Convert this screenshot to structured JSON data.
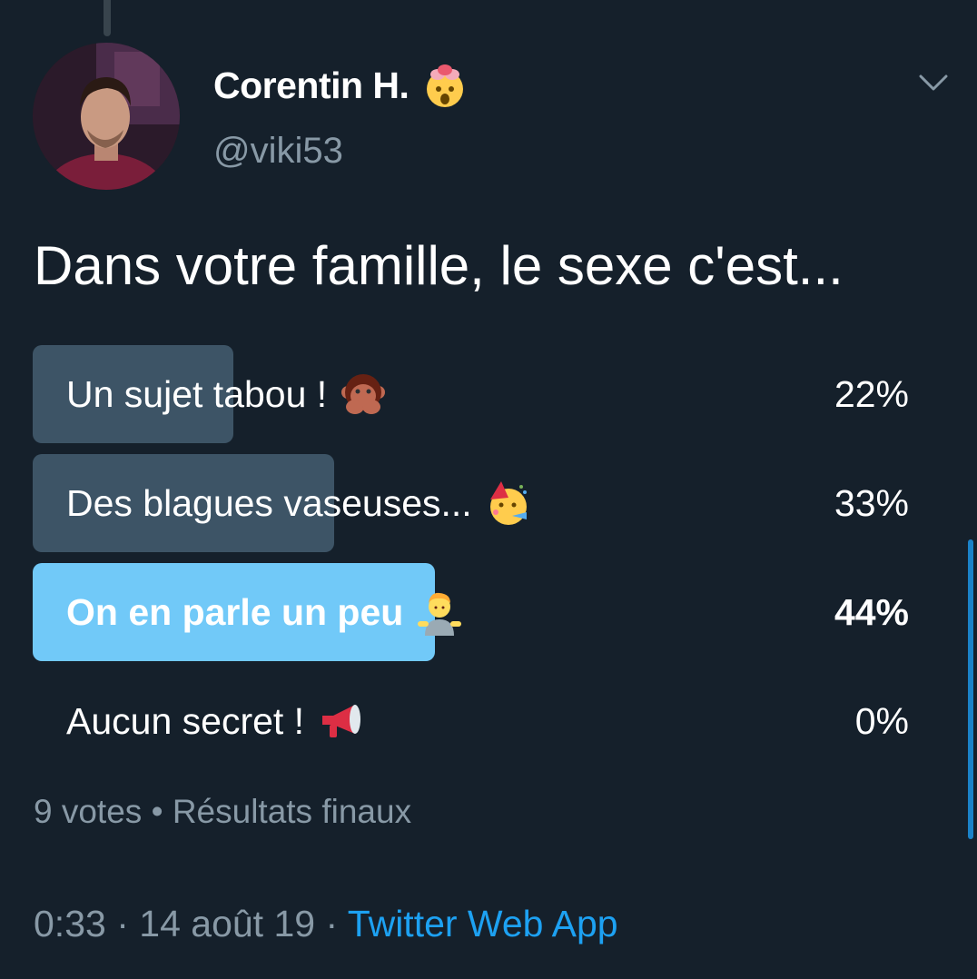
{
  "author": {
    "display_name": "Corentin H.",
    "name_emoji": "exploding-head-emoji",
    "handle": "@viki53"
  },
  "tweet": {
    "text": "Dans votre famille, le sexe c'est..."
  },
  "poll": {
    "options": [
      {
        "label": "Un sujet tabou !",
        "emoji": "speak-no-evil-monkey-emoji",
        "percent_label": "22%",
        "percent": 22,
        "winner": false
      },
      {
        "label": "Des blagues vaseuses...",
        "emoji": "partying-face-emoji",
        "percent_label": "33%",
        "percent": 33,
        "winner": false
      },
      {
        "label": "On en parle un peu",
        "emoji": "person-shrugging-emoji",
        "percent_label": "44%",
        "percent": 44,
        "winner": true
      },
      {
        "label": "Aucun secret !",
        "emoji": "megaphone-emoji",
        "percent_label": "0%",
        "percent": 0,
        "winner": false
      }
    ],
    "votes": "9 votes",
    "separator": "•",
    "status": "Résultats finaux"
  },
  "meta": {
    "time": "0:33",
    "date": "14 août 19",
    "dot": "·",
    "source": "Twitter Web App"
  },
  "colors": {
    "background": "#15202b",
    "bar": "#3d5466",
    "winner_bar": "#71c9f8",
    "muted_text": "#8899a6",
    "link": "#1da1f2"
  }
}
